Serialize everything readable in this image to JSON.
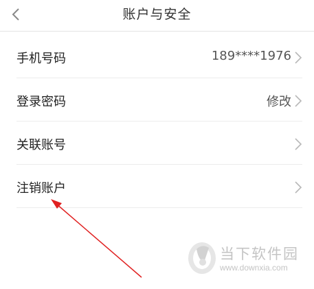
{
  "header": {
    "title": "账户与安全"
  },
  "rows": [
    {
      "label": "手机号码",
      "value": "189****1976"
    },
    {
      "label": "登录密码",
      "value": "修改"
    },
    {
      "label": "关联账号",
      "value": ""
    },
    {
      "label": "注销账户",
      "value": ""
    }
  ],
  "watermark": {
    "text": "当下软件园",
    "url": "www.downxia.com"
  },
  "annotation": {
    "arrow_color": "#e02020"
  },
  "colors": {
    "chevron": "#b8b8b8",
    "divider": "#ececec"
  }
}
